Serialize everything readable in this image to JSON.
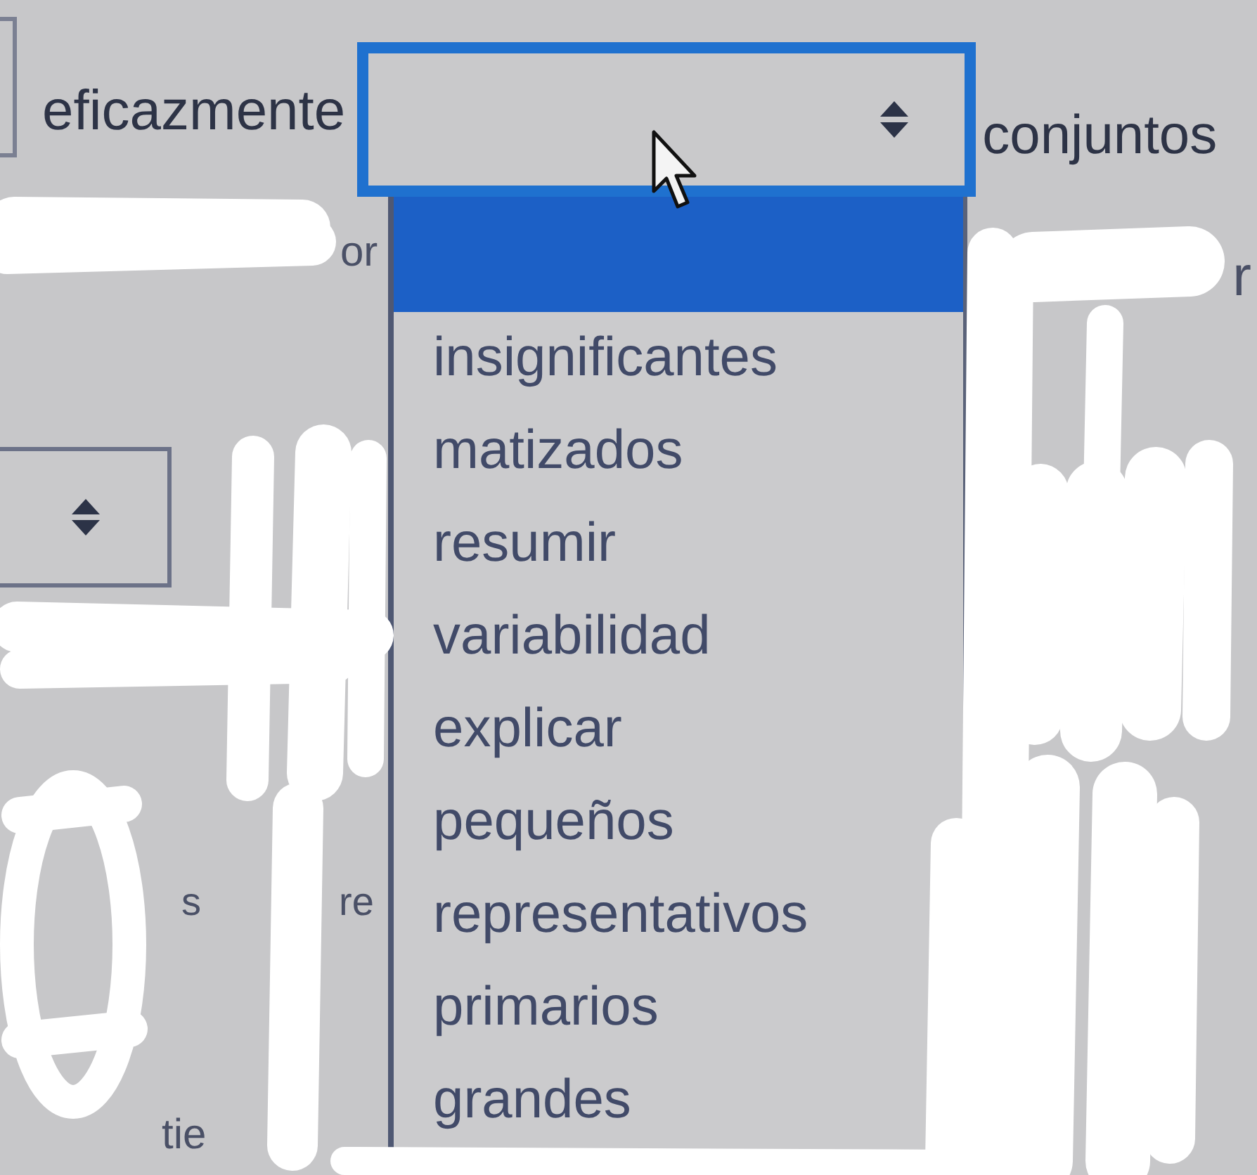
{
  "row_1": {
    "text_before": "eficazmente",
    "dropdown": {
      "focused": true,
      "open": true,
      "options": [
        {
          "selected": true
        },
        {
          "label": "insignificantes",
          "selected": false
        },
        {
          "label": "matizados",
          "selected": false
        },
        {
          "label": "resumir",
          "selected": false
        },
        {
          "label": "variabilidad",
          "selected": false
        },
        {
          "label": "explicar",
          "selected": false
        },
        {
          "label": "pequeños",
          "selected": false
        },
        {
          "label": "representativos",
          "selected": false
        },
        {
          "label": "primarios",
          "selected": false
        },
        {
          "label": "grandes",
          "selected": false
        }
      ]
    },
    "text_after": "conjuntos"
  },
  "row_2": {
    "fragment_left": "or",
    "fragment_right": "r"
  },
  "row_3": {
    "dropdown": {
      "focused": false
    }
  },
  "row_4": {
    "fragments": [
      "s",
      "re"
    ]
  },
  "row_5": {
    "fragments": [
      "tie"
    ]
  }
}
